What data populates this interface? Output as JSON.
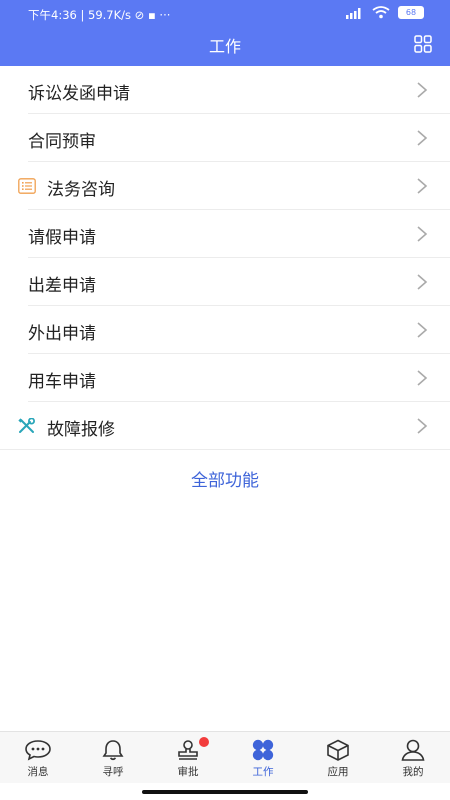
{
  "status_bar": {
    "left_text": "下午4:36 | 59.7K/s ⊘ ▪ ···",
    "battery": "68"
  },
  "header": {
    "title": "工作",
    "grid_icon": "grid-icon"
  },
  "list": {
    "items": [
      {
        "label": "诉讼发函申请",
        "icon": null
      },
      {
        "label": "合同预审",
        "icon": null
      },
      {
        "label": "法务咨询",
        "icon": "list-icon",
        "icon_color": "#f0a050"
      },
      {
        "label": "请假申请",
        "icon": null
      },
      {
        "label": "出差申请",
        "icon": null
      },
      {
        "label": "外出申请",
        "icon": null
      },
      {
        "label": "用车申请",
        "icon": null
      },
      {
        "label": "故障报修",
        "icon": "wrench-screwdriver-icon",
        "icon_color": "#2aa6b9"
      }
    ],
    "all_functions_label": "全部功能"
  },
  "tabbar": {
    "tabs": [
      {
        "label": "消息",
        "icon": "chat-bubble-icon"
      },
      {
        "label": "寻呼",
        "icon": "bell-icon"
      },
      {
        "label": "审批",
        "icon": "stamp-icon",
        "badge": true
      },
      {
        "label": "工作",
        "icon": "clover-icon",
        "active": true
      },
      {
        "label": "应用",
        "icon": "cube-icon"
      },
      {
        "label": "我的",
        "icon": "person-icon"
      }
    ]
  },
  "colors": {
    "header_bg": "#5b79f3",
    "accent": "#3e64d9",
    "badge": "#f23c3c"
  }
}
